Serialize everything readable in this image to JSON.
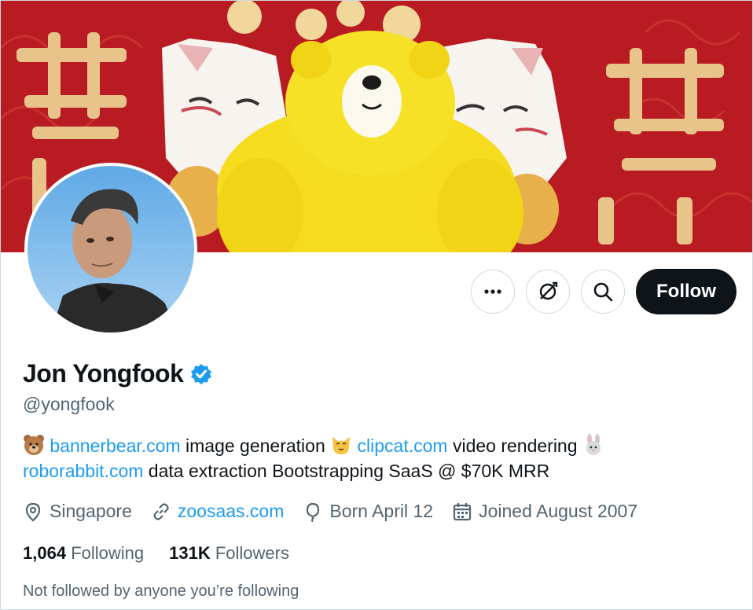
{
  "header": {
    "follow_label": "Follow"
  },
  "icons": {
    "more": "more-icon",
    "subscribe": "notifications-icon",
    "search": "search-icon"
  },
  "profile": {
    "name": "Jon Yongfook",
    "handle": "@yongfook",
    "bio": {
      "link1": "bannerbear.com",
      "text1": " image generation ",
      "link2": "clipcat.com",
      "text2": " video rendering ",
      "link3": "roborabbit.com",
      "text3": " data extraction Bootstrapping SaaS @ $70K MRR"
    },
    "location": "Singapore",
    "website": "zoosaas.com",
    "birthday": "Born April 12",
    "joined": "Joined August 2007"
  },
  "stats": {
    "following_count": "1,064",
    "following_label": "Following",
    "followers_count": "131K",
    "followers_label": "Followers"
  },
  "follow_note": "Not followed by anyone you’re following",
  "colors": {
    "link": "#1d9bf0",
    "verified": "#1d9bf0",
    "text": "#0f1419",
    "muted": "#536471",
    "banner": "#b81c22"
  }
}
